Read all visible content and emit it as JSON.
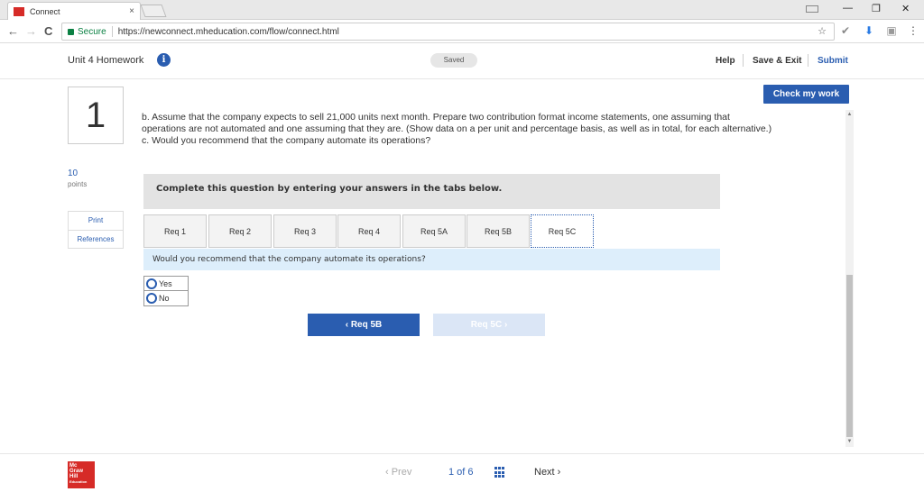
{
  "browser": {
    "tab_title": "Connect",
    "tab_close": "×",
    "secure_label": "Secure",
    "url": "https://newconnect.mheducation.com/flow/connect.html",
    "star": "☆",
    "back": "←",
    "forward": "→",
    "reload": "C",
    "minimize": "—",
    "restore": "❐",
    "close": "✕",
    "menu": "⋮"
  },
  "header": {
    "title": "Unit 4 Homework",
    "info_icon": "i",
    "saved": "Saved",
    "help": "Help",
    "save_exit": "Save & Exit",
    "submit": "Submit"
  },
  "question": {
    "number": "1",
    "points_value": "10",
    "points_label": "points",
    "print": "Print",
    "references": "References",
    "check_label": "Check my work",
    "text_b": "b. Assume that the company expects to sell 21,000 units next month. Prepare two contribution format income statements, one assuming that operations are not automated and one assuming that they are. (Show data on a per unit and percentage basis, as well as in total, for each alternative.)",
    "text_c": "c. Would you recommend that the company automate its operations?",
    "banner": "Complete this question by entering your answers in the tabs below.",
    "tabs": [
      "Req 1",
      "Req 2",
      "Req 3",
      "Req 4",
      "Req 5A",
      "Req 5B",
      "Req 5C"
    ],
    "active_tab": "Req 5C",
    "prompt": "Would you recommend that the company automate its operations?",
    "options": [
      "Yes",
      "No"
    ],
    "prev_button": "‹  Req 5B",
    "next_button": "Req 5C  ›"
  },
  "footer": {
    "logo_lines": [
      "Mc",
      "Graw",
      "Hill",
      "Education"
    ],
    "prev": "‹  Prev",
    "position": "1  of  6",
    "next": "Next  ›"
  },
  "colors": {
    "brand_blue": "#2a5db0",
    "brand_red": "#d62b27",
    "prompt_bg": "#ddeefb"
  }
}
